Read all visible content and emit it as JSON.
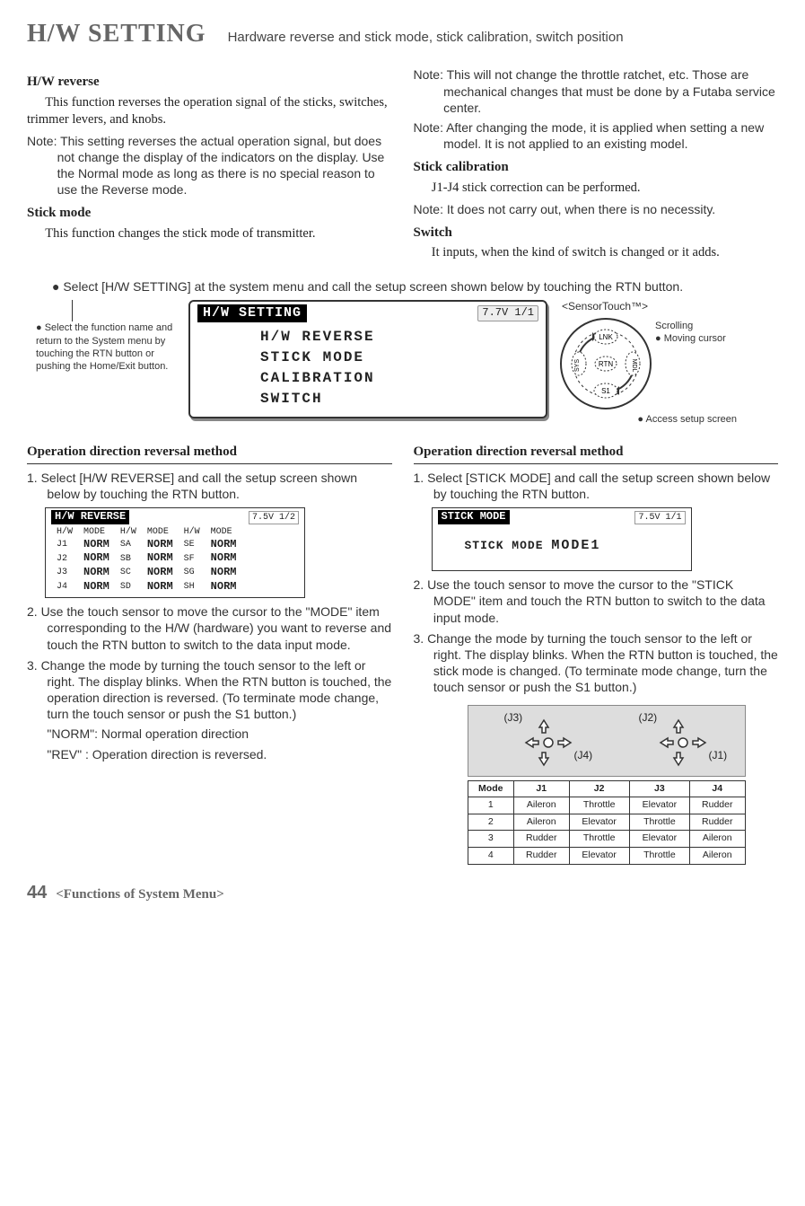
{
  "header": {
    "title": "H/W SETTING",
    "subtitle": "Hardware reverse and stick mode, stick calibration, switch position"
  },
  "left_intro": {
    "hwr_title": "H/W reverse",
    "hwr_body": "This function reverses the operation signal of the sticks, switches, trimmer levers, and knobs.",
    "hwr_note": "Note: This setting reverses the actual operation signal, but does not change the display of the indicators on the display. Use the Normal mode as long as there is no special reason to use the Reverse mode.",
    "sm_title": "Stick mode",
    "sm_body": "This function changes the stick mode of transmitter."
  },
  "right_intro": {
    "note1": "Note: This will not change the throttle ratchet, etc. Those are mechanical changes that must be done by a Futaba service center.",
    "note2": "Note: After changing the mode, it is applied when setting a new model. It is not applied to an existing model.",
    "sc_title": "Stick calibration",
    "sc_body": "J1-J4 stick correction can be performed.",
    "sc_note": "Note: It does not carry out, when there is no necessity.",
    "sw_title": "Switch",
    "sw_body": "It inputs, when the kind of switch is changed or it adds."
  },
  "center": {
    "instruct": "● Select [H/W SETTING] at the system menu and call the setup screen shown below by touching the RTN button.",
    "left_caption": "● Select the function name and return to the System menu by touching the RTN button or pushing the Home/Exit button.",
    "lcd": {
      "title": "H/W SETTING",
      "page": "7.7V 1/1",
      "lines": [
        "H/W REVERSE",
        "STICK MODE",
        "CALIBRATION",
        "SWITCH"
      ]
    },
    "sensor": {
      "label": "<SensorTouch™>",
      "line1": "Scrolling",
      "line2": "● Moving cursor",
      "line3": "● Access setup screen",
      "btn_lnk": "LNK",
      "btn_sys": "SYS",
      "btn_mdl": "MDL",
      "btn_rtn": "RTN",
      "btn_s1": "S1"
    }
  },
  "left_proc": {
    "subhead": "Operation direction reversal method",
    "step1": "1. Select [H/W REVERSE] and call the setup screen shown below by touching the RTN button.",
    "lcd": {
      "title": "H/W REVERSE",
      "page": "7.5V 1/2",
      "headers": [
        "H/W",
        "MODE",
        "H/W",
        "MODE",
        "H/W",
        "MODE"
      ],
      "rows": [
        [
          "J1",
          "NORM",
          "SA",
          "NORM",
          "SE",
          "NORM"
        ],
        [
          "J2",
          "NORM",
          "SB",
          "NORM",
          "SF",
          "NORM"
        ],
        [
          "J3",
          "NORM",
          "SC",
          "NORM",
          "SG",
          "NORM"
        ],
        [
          "J4",
          "NORM",
          "SD",
          "NORM",
          "SH",
          "NORM"
        ]
      ]
    },
    "step2": "2. Use the touch sensor to move the cursor to the \"MODE\" item corresponding to the H/W (hardware) you want to reverse and touch the RTN button to switch to the data input mode.",
    "step3": "3. Change the mode by turning the touch sensor to the left or right. The display blinks. When the RTN button is touched, the operation direction is reversed. (To terminate mode change, turn the touch sensor or push the S1 button.)",
    "def1": "\"NORM\": Normal operation direction",
    "def2": "\"REV\" : Operation direction is reversed."
  },
  "right_proc": {
    "subhead": "Operation direction reversal method",
    "step1": "1. Select [STICK MODE] and call the setup screen shown below by touching the RTN button.",
    "lcd": {
      "title": "STICK MODE",
      "page": "7.5V 1/1",
      "label": "STICK MODE",
      "value": "MODE1"
    },
    "step2": "2. Use the touch sensor to move the cursor to the \"STICK MODE\" item and touch the RTN button to switch to the data input mode.",
    "step3": "3. Change the mode by turning the touch sensor to the left or right. The display blinks. When the RTN button is touched, the stick mode is changed. (To terminate mode change, turn the touch sensor or push the S1 button.)",
    "stick_labels": {
      "j1": "(J1)",
      "j2": "(J2)",
      "j3": "(J3)",
      "j4": "(J4)"
    },
    "table": {
      "headers": [
        "Mode",
        "J1",
        "J2",
        "J3",
        "J4"
      ],
      "rows": [
        [
          "1",
          "Aileron",
          "Throttle",
          "Elevator",
          "Rudder"
        ],
        [
          "2",
          "Aileron",
          "Elevator",
          "Throttle",
          "Rudder"
        ],
        [
          "3",
          "Rudder",
          "Throttle",
          "Elevator",
          "Aileron"
        ],
        [
          "4",
          "Rudder",
          "Elevator",
          "Throttle",
          "Aileron"
        ]
      ]
    }
  },
  "footer": {
    "page": "44",
    "label": "<Functions of System Menu>"
  }
}
